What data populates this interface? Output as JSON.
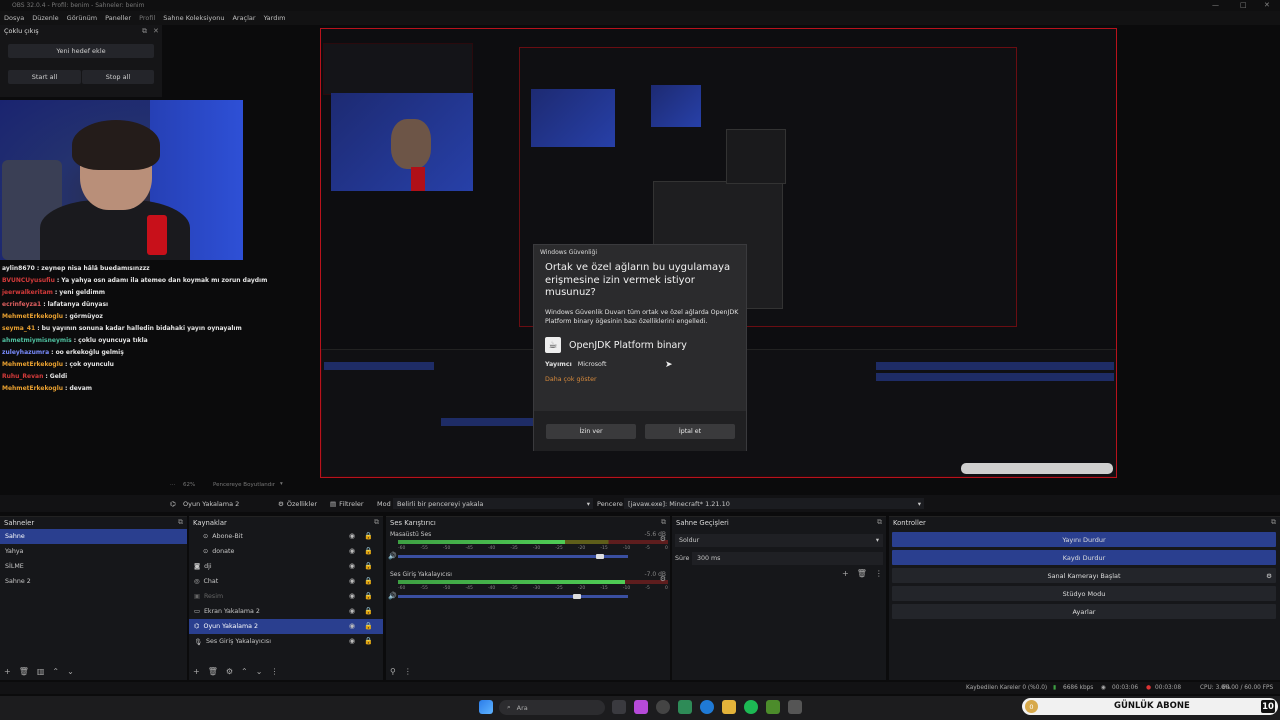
{
  "window": {
    "title": "OBS 32.0.4 - Profil: benim - Sahneler: benim"
  },
  "menu": [
    "Dosya",
    "Düzenle",
    "Görünüm",
    "Paneller",
    "Profil",
    "Sahne Koleksiyonu",
    "Araçlar",
    "Yardım"
  ],
  "multi_output": {
    "title": "Çoklu çıkış",
    "new_target": "Yeni hedef ekle",
    "start_all": "Start all",
    "stop_all": "Stop all"
  },
  "chat": [
    {
      "user": "aylin8670",
      "color": "#e8e8e8",
      "msg": "zeynep nisa hâlâ buedamısınzzz"
    },
    {
      "user": "BVUNCUyusufiu",
      "color": "#d43a3a",
      "msg": "Ya yahya osn adamı ila atemeo dan koymak mı zorun daydım"
    },
    {
      "user": "jeerwalkeritam",
      "color": "#d43a3a",
      "msg": "yeni geldimm"
    },
    {
      "user": "ecrinfeyza1",
      "color": "#e06060",
      "msg": "lafatanya dünyası"
    },
    {
      "user": "MehmetErkekoglu",
      "color": "#e8a030",
      "msg": "görmüyoz"
    },
    {
      "user": "seyma_41",
      "color": "#e8a030",
      "msg": "bu yayının sonuna kadar halledin bidahaki yayın oynayalım"
    },
    {
      "user": "ahmetmiymisneymis",
      "color": "#4fc0a0",
      "msg": "çoklu oyuncuya tıkla"
    },
    {
      "user": "zuleyhazumra",
      "color": "#7a8cff",
      "msg": "oo erkekoğlu gelmiş"
    },
    {
      "user": "MehmetErkekoglu",
      "color": "#e8a030",
      "msg": "çok oyunculu"
    },
    {
      "user": "Ruhu_Revan",
      "color": "#d43a3a",
      "msg": "Geldi"
    },
    {
      "user": "MehmetErkekoglu",
      "color": "#e8a030",
      "msg": "devam"
    }
  ],
  "dialog": {
    "caption": "Windows Güvenliği",
    "heading": "Ortak ve özel ağların bu uygulamaya erişmesine izin vermek istiyor musunuz?",
    "desc": "Windows Güvenlik Duvarı tüm ortak ve özel ağlarda OpenJDK Platform binary öğesinin bazı özelliklerini engelledi.",
    "app_name": "OpenJDK Platform binary",
    "publisher_label": "Yayımcı",
    "publisher": "Microsoft",
    "more": "Daha çok göster",
    "allow": "İzin ver",
    "cancel": "İptal et"
  },
  "zoom": {
    "value": "62%",
    "label": "Pencereye Boyutlandır"
  },
  "source_bar": {
    "source": "Oyun Yakalama 2",
    "properties": "Özellikler",
    "filters": "Filtreler",
    "mode_label": "Mod",
    "mode": "Belirli bir pencereyi yakala",
    "window_label": "Pencere",
    "window": "[javaw.exe]: Minecraft* 1.21.10"
  },
  "scenes": {
    "title": "Sahneler",
    "items": [
      "Sahne",
      "Yahya",
      "SİLME",
      "Sahne 2"
    ],
    "selected": 0
  },
  "sources": {
    "title": "Kaynaklar",
    "items": [
      {
        "name": "Abone-Bit",
        "icon": "group-icon",
        "indent": true
      },
      {
        "name": "donate",
        "icon": "group-icon",
        "indent": true
      },
      {
        "name": "dji",
        "icon": "camera-icon",
        "indent": false
      },
      {
        "name": "Chat",
        "icon": "browser-icon",
        "indent": false
      },
      {
        "name": "Resim",
        "icon": "image-icon",
        "indent": false,
        "dim": true
      },
      {
        "name": "Ekran Yakalama 2",
        "icon": "monitor-icon",
        "indent": false
      },
      {
        "name": "Oyun Yakalama 2",
        "icon": "gamepad-icon",
        "indent": false,
        "selected": true
      },
      {
        "name": "Ses Giriş Yakalayıcısı",
        "icon": "mic-icon",
        "indent": false
      }
    ]
  },
  "mixer": {
    "title": "Ses Karıştırıcı",
    "channels": [
      {
        "name": "Masaüstü Ses",
        "db": "-5.6 dB",
        "level": 0.62,
        "volume": 0.86
      },
      {
        "name": "Ses Giriş Yakalayıcısı",
        "db": "-7.0 dB",
        "level": 0.84,
        "volume": 0.76
      }
    ],
    "scale": [
      "-60",
      "-55",
      "-50",
      "-45",
      "-40",
      "-35",
      "-30",
      "-25",
      "-20",
      "-15",
      "-10",
      "-5",
      "0"
    ]
  },
  "transitions": {
    "title": "Sahne Geçişleri",
    "type": "Soldur",
    "duration_label": "Süre",
    "duration": "300 ms"
  },
  "controls": {
    "title": "Kontroller",
    "buttons": [
      {
        "label": "Yayını Durdur",
        "active": true
      },
      {
        "label": "Kaydı Durdur",
        "active": true
      },
      {
        "label": "Sanal Kamerayı Başlat",
        "active": false
      },
      {
        "label": "Stüdyo Modu",
        "active": false
      },
      {
        "label": "Ayarlar",
        "active": false
      }
    ]
  },
  "status": {
    "dropped": "Kaybedilen Kareler 0 (%0.0)",
    "kbps": "6686 kbps",
    "stream_time": "00:03:06",
    "rec_time": "00:03:08",
    "cpu": "CPU: 3.0%",
    "fps": "60.00 / 60.00 FPS"
  },
  "taskbar": {
    "search": "Ara"
  },
  "goal": {
    "current": "0",
    "label": "GÜNLÜK ABONE",
    "target": "10"
  }
}
